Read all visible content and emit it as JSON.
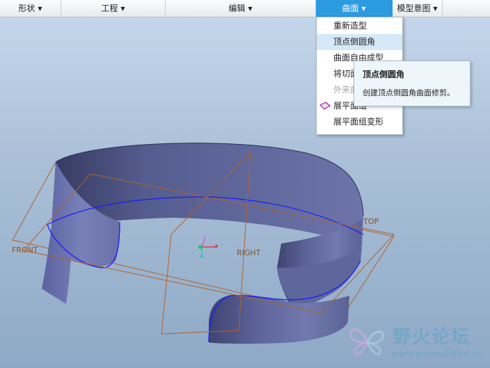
{
  "toolbar": {
    "items": [
      {
        "label": "形状"
      },
      {
        "label": "工程"
      },
      {
        "label": "编辑"
      },
      {
        "label": "曲面"
      },
      {
        "label": "模型意图"
      }
    ],
    "dropdown_glyph": "▼"
  },
  "surface_menu": {
    "items": [
      {
        "label": "重新造型"
      },
      {
        "label": "顶点倒圆角"
      },
      {
        "label": "曲面自由成型"
      },
      {
        "label": "将切面"
      },
      {
        "label": "外来曲面"
      },
      {
        "label": "展平面组",
        "icon": "flatten-quilt-icon"
      },
      {
        "label": "展平面组变形"
      }
    ],
    "hovered_item": "顶点倒圆角"
  },
  "tooltip": {
    "title": "顶点倒圆角",
    "description": "创建顶点倒圆角曲面修剪。"
  },
  "viewport": {
    "datum_labels": {
      "front": "FRONT",
      "top": "TOP",
      "right": "RIGHT"
    },
    "colors": {
      "surface": "#6e75aa",
      "surface_dark": "#474c78",
      "edge_highlight": "#1a1aff",
      "datum_plane": "#b0622a"
    }
  },
  "watermark": {
    "title": "野火论坛",
    "url": "www.proewildfire.cn"
  }
}
